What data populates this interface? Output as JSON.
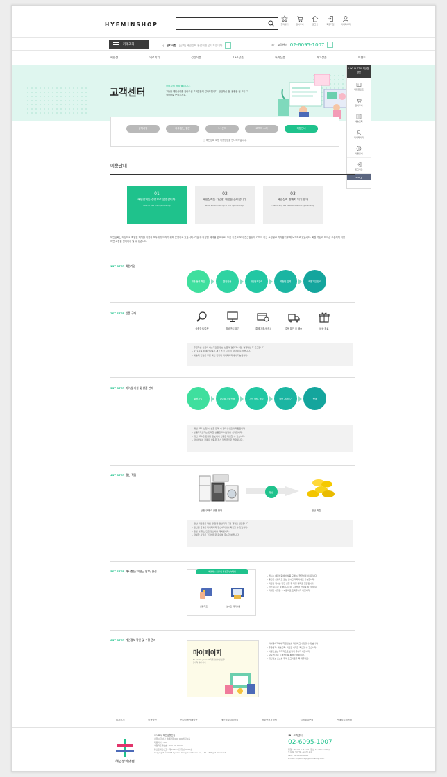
{
  "header": {
    "logo": "HYEMINSHOP",
    "search_placeholder": "",
    "icons": [
      {
        "icon": "star-icon",
        "label": "즐겨찾기"
      },
      {
        "icon": "cart-icon",
        "label": "장바구니"
      },
      {
        "icon": "home-icon",
        "label": "로그인"
      },
      {
        "icon": "login-icon",
        "label": "회원가입"
      },
      {
        "icon": "user-icon",
        "label": "마이페이지"
      }
    ],
    "category_label": "카테고리",
    "notice_label": "공지사항",
    "notice_text": "[공지] 혜민상회 통합회원 안내드립니다",
    "tel_label": "고객센터",
    "tel_number": "02-6095-1007"
  },
  "menu": [
    "혜민샵",
    "의료기기",
    "건강식품",
    "1+1상품",
    "특가상품",
    "재고상품",
    "이벤트"
  ],
  "hero": {
    "title": "고객센터",
    "subtitle": "소비자의 정성 몰입니다.",
    "desc": "그동안 혜민상회를 찾아주신 고객분들께 감사드립니다. 궁금하신 점, 불편한 점 모두 고객센터로 문의주세요."
  },
  "tabs": [
    {
      "label": "공지사항",
      "active": false
    },
    {
      "label": "자주 묻는 질문",
      "active": false
    },
    {
      "label": "1:1문의",
      "active": false
    },
    {
      "label": "고객의 소리",
      "active": false
    },
    {
      "label": "이용안내",
      "active": true
    }
  ],
  "tab_note": "ⓘ 혜민상회 쇼핑 이용방법을 안내해드립니다.",
  "quick_menu": {
    "head": "LOG IN STAY 최근본상품",
    "items": [
      {
        "icon": "coupon-icon",
        "label": "혜민포인트"
      },
      {
        "icon": "cart-icon",
        "label": "장바구니"
      },
      {
        "icon": "truck-icon",
        "label": "배송조회"
      },
      {
        "icon": "user-icon",
        "label": "마이페이지"
      },
      {
        "icon": "info-icon",
        "label": "이용안내"
      },
      {
        "icon": "logout-icon",
        "label": "로그아웃"
      }
    ],
    "top_label": "TOP ▲"
  },
  "section": {
    "title": "이용안내",
    "boxes": [
      {
        "num": "01",
        "text": "혜민상회는 정성으로 운영합니다.",
        "sub": "How to use the hyeminshop",
        "active": true
      },
      {
        "num": "02",
        "text": "혜민상회는 다양한 제품을 준비합니다.",
        "sub": "What's the make-up of the hyeminshop?",
        "active": false
      },
      {
        "num": "03",
        "text": "혜민상회 판매자 되기 안내",
        "sub": "That is why we have to see the hyeminshop",
        "active": false
      }
    ],
    "intro": "혜민상회는 다양하고 특별한 혜택을 사용자 모두에게 드리기 위해 운영하고 있습니다. 가입 후 다양한 혜택을 받으세요. 또한 이웃고 보다 친근감있게 가까이 하는 쇼핑몰로 자리잡기 위해 노력하고 있습니다. 회원 가입과 마이샵 오픈까지 이용하면 쇼핑몰 판매자가 될 수 있습니다."
  },
  "steps": {
    "s1": {
      "tag": "1ST STEP",
      "title": "회원가입",
      "circles": [
        "약관 동의 확인",
        "본인인증",
        "개인정보입력",
        "추천인 입력",
        "회원가입 완료"
      ]
    },
    "s2": {
      "tag": "2ST STEP",
      "title": "상품 구매",
      "icons": [
        {
          "icon": "search-icon",
          "label": "상품검색/주문"
        },
        {
          "icon": "monitor-icon",
          "label": "장바구니 담기"
        },
        {
          "icon": "card-icon",
          "label": "결제(계좌/카드)"
        },
        {
          "icon": "delivery-icon",
          "label": "주문 확인 후 배송"
        },
        {
          "icon": "gift-icon",
          "label": "배송 완료"
        }
      ],
      "notes": [
        "- 주문하신 상품의 배송기간은 일반 상품의 경우 3~5일, 결제확인 후 출고됩니다.",
        "- 1+1상품 및 특가상품은 재고 소진 시 조기 마감될 수 있습니다.",
        "- 배송지 변경은 주문 확인 전까지 마이페이지에서 가능합니다."
      ]
    },
    "s3": {
      "tag": "3ST STEP",
      "title": "마이샵 개설 및 상품 판매",
      "circles": [
        "회원가입",
        "마이샵 개설신청",
        "개인 URL 생성",
        "상품 가져오기",
        "판매"
      ],
      "notes": [
        "- 개인 URL 신청 시 상품 판매 시 판매수수료가 적립됩니다.",
        "- 상품가져오기는 판매할 상품을 마이샵에서 선택합니다.",
        "- 개인 URL은 판매자 정보에서 언제든 확인할 수 있습니다.",
        "- 마이샵에서 판매된 상품은 정산 적립금으로 전환됩니다."
      ]
    },
    "s4": {
      "tag": "4ST STEP",
      "title": "정산 적립",
      "cap_left": "상품 구매 & 상품 판매",
      "pill": "정산",
      "cap_right": "정산 적립",
      "notes": [
        "- 정산 적립금은 매월 말 일괄 정산되며 지정 계좌로 입금됩니다.",
        "- 정산된 금액은 마이페이지 정산내역에서 확인할 수 있습니다.",
        "- 환불 및 취소 건은 정산에서 제외됩니다.",
        "- 자세한 사항은 고객센터로 문의해 주시기 바랍니다."
      ]
    },
    "s5": {
      "tag": "5ST STEP",
      "title": "캐시충전/ 이용금 납부/ 환전",
      "pill": "혜민캐시 충전 및 환전금 납부방법",
      "left": "신용카드",
      "right": "실시간 계좌이체",
      "notes": [
        "- 캐시는 혜민상회에서 상품 구매 시 현금처럼 사용됩니다.",
        "- 충전은 신용카드 또는 실시간 계좌이체로 가능합니다.",
        "- 적립된 캐시는 환전 신청 후 지정 계좌로 입금됩니다.",
        "- 환전 수수료 및 처리기간은 고객센터 안내를 참고하세요.",
        "- 자세한 사항은 1:1 문의로 연락주시기 바랍니다."
      ]
    },
    "s6": {
      "tag": "6ST STEP",
      "title": "개인정보 확인 및 수정 관리",
      "mypage_title": "마이페이지",
      "mypage_sub": "Be kinder yourself 회원정보 수정 및 주문내역 확인 안내",
      "notes": [
        "- 마이페이지에서 회원정보를 확인하고 수정할 수 있습니다.",
        "- 주문내역, 배송조회, 적립금 내역을 확인할 수 있습니다.",
        "- 비밀번호는 주기적으로 변경해 주시기 바랍니다.",
        "- 탈퇴 신청은 고객센터를 통해 진행됩니다.",
        "- 개인정보 보호를 위해 로그아웃을 꼭 해주세요."
      ]
    }
  },
  "footer": {
    "links": [
      "회사소개",
      "이용약관",
      "전자금융거래약관",
      "개인정보처리방침",
      "청소년보호정책",
      "입점제휴문의",
      "판매자고객센터"
    ],
    "logo_text": "혜민상회닷컴",
    "company": "주식회사 혜민생활건강",
    "address": "서울시 강남구 테헤란로 000 000빌딩 0층",
    "ceo": "대표이사 : 000",
    "biz": "사업자등록번호 : 000-00-00000",
    "report": "통신판매업신고 : 제 2018-서울강남-0000호",
    "copyright": "Copyright © 2018 hyemin.living healthcare Co., Ltd. All Right Reserved.",
    "cs_title": "고객센터",
    "cs_number": "02-6095-1007",
    "cs_hours": "평일 : 10:00 ~ 17:00 (점심 12:00~13:00)",
    "cs_off": "토요일, 일요일, 공휴일 휴무",
    "cs_fax": "Fax : 02-0000-0000",
    "cs_email": "E-mail : hyemin@hyeminshop.com"
  },
  "colors": {
    "accent": "#1fc28c",
    "hero_bg": "#dff6ef",
    "dark": "#3b3b3b"
  }
}
